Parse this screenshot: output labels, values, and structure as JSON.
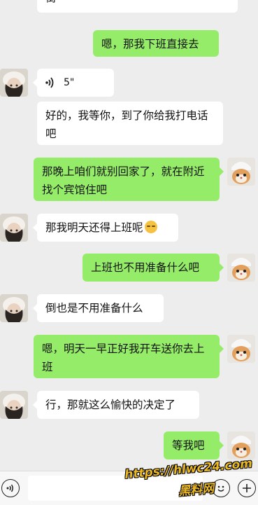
{
  "messages": [
    {
      "side": "in",
      "text": "街"
    },
    {
      "side": "out",
      "text": "嗯，那我下班直接去"
    },
    {
      "side": "in",
      "type": "voice",
      "duration": "5\""
    },
    {
      "side": "in",
      "text": "好的，我等你，到了你给我打电话吧"
    },
    {
      "side": "out",
      "text": "那晚上咱们就别回家了，就在附近找个宾馆住吧"
    },
    {
      "side": "in",
      "text": "那我明天还得上班呢"
    },
    {
      "side": "out",
      "text": "上班也不用准备什么吧"
    },
    {
      "side": "in",
      "text": "倒也是不用准备什么"
    },
    {
      "side": "out",
      "text": "嗯，明天一早正好我开车送你去上班"
    },
    {
      "side": "in",
      "text": "行，那就这么愉快的决定了"
    },
    {
      "side": "out",
      "text": "等我吧"
    }
  ],
  "watermark": {
    "line1": "https://hlwc24.com",
    "line2": "黑料网"
  },
  "colors": {
    "background": "#ededed",
    "outgoing": "#95ec69",
    "incoming": "#ffffff",
    "watermark": "#e9b824"
  }
}
